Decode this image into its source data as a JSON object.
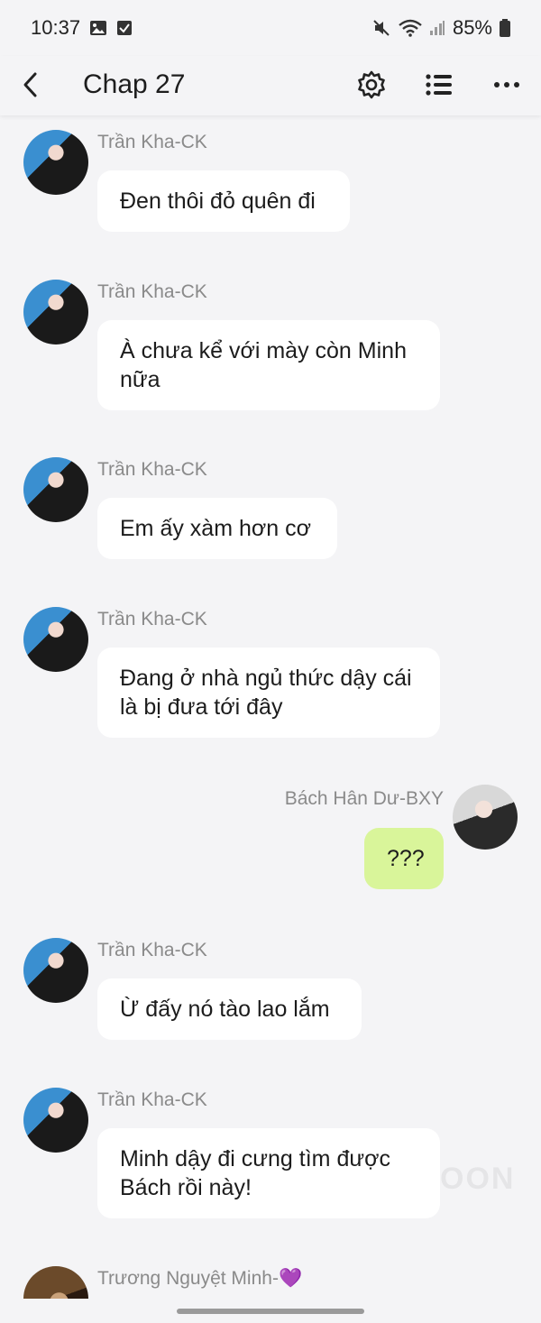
{
  "status_bar": {
    "time": "10:37",
    "battery": "85%",
    "icons": [
      "gallery-icon",
      "checkbox-icon",
      "mute-icon",
      "wifi-icon",
      "signal-icon",
      "battery-icon"
    ]
  },
  "header": {
    "title": "Chap 27",
    "icons": [
      "back-arrow-icon",
      "gear-icon",
      "list-icon",
      "more-dots-icon"
    ]
  },
  "messages": [
    {
      "sender": "Trần Kha-CK",
      "text": "Đen thôi đỏ quên đi",
      "side": "left"
    },
    {
      "sender": "Trần Kha-CK",
      "text": "À chưa kể với mày còn Minh nữa",
      "side": "left"
    },
    {
      "sender": "Trần Kha-CK",
      "text": "Em ấy xàm hơn cơ",
      "side": "left"
    },
    {
      "sender": "Trần Kha-CK",
      "text": "Đang ở nhà ngủ thức dậy cái là bị đưa tới đây",
      "side": "left"
    },
    {
      "sender": "Bách Hân Dư-BXY",
      "text": "???",
      "side": "right"
    },
    {
      "sender": "Trần Kha-CK",
      "text": "Ừ đấy nó tào lao lắm",
      "side": "left"
    },
    {
      "sender": "Trần Kha-CK",
      "text": "Minh dậy đi cưng tìm được Bách rồi này!",
      "side": "left"
    },
    {
      "sender": "Trương Nguyệt Minh-💜",
      "text": "",
      "side": "left"
    }
  ],
  "colors": {
    "background": "#f4f4f6",
    "bubble_other": "#ffffff",
    "bubble_mine": "#d9f59a",
    "sender_text": "#8a8a8a"
  }
}
